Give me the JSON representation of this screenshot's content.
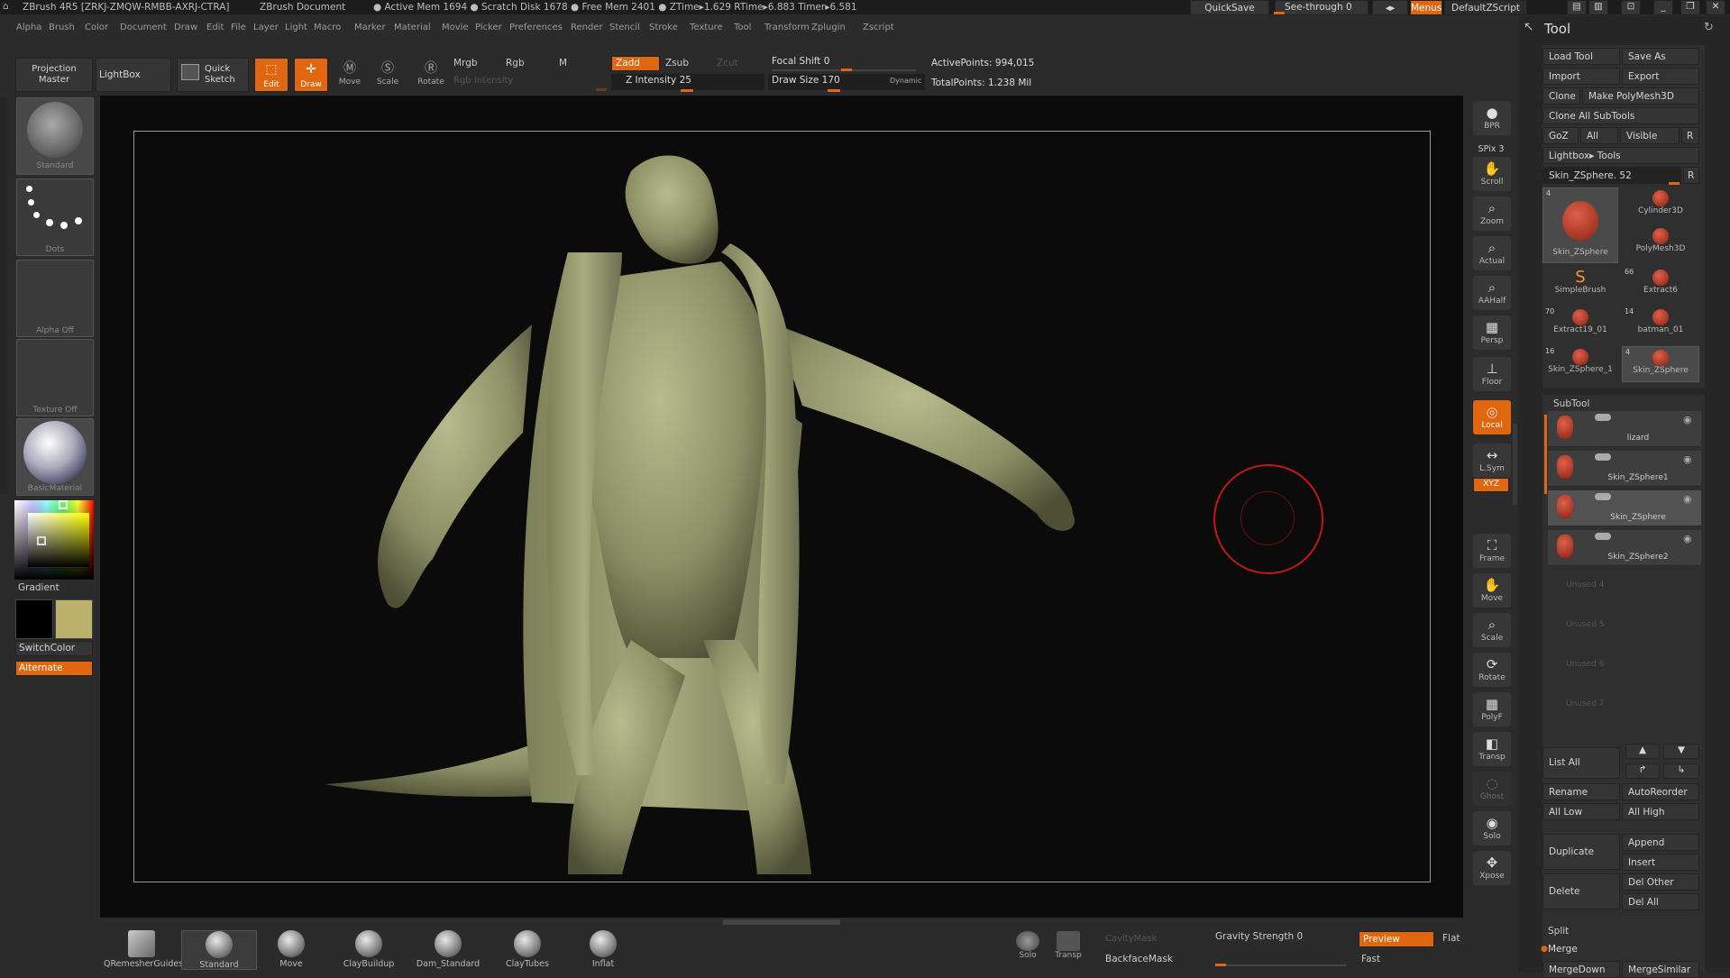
{
  "title_bar": {
    "app": "ZBrush 4R5 [ZRKJ-ZMQW-RMBB-AXRJ-CTRA]",
    "doc": "ZBrush Document",
    "stats": "● Active Mem 1694 ● Scratch Disk 1678 ● Free Mem 2401 ● ZTime▸1.629 RTime▸6.883 Timer▸6.581",
    "quicksave": "QuickSave",
    "see_through": "See-through  0",
    "menus": "Menus",
    "script": "DefaultZScript"
  },
  "menu": [
    "Alpha",
    "Brush",
    "Color",
    "Document",
    "Draw",
    "Edit",
    "File",
    "Layer",
    "Light",
    "Macro",
    "Marker",
    "Material",
    "Movie",
    "Picker",
    "Preferences",
    "Render",
    "Stencil",
    "Stroke",
    "Texture",
    "Tool",
    "Transform",
    "Zplugin",
    "Zscript"
  ],
  "toolbar": {
    "projection_master": "Projection Master",
    "lightbox": "LightBox",
    "quick_sketch": "Quick Sketch",
    "edit": "Edit",
    "draw": "Draw",
    "move": "Move",
    "scale": "Scale",
    "rotate": "Rotate",
    "mrgb": "Mrgb",
    "rgb": "Rgb",
    "m": "M",
    "rgb_intensity": "Rgb Intensity",
    "zadd": "Zadd",
    "zsub": "Zsub",
    "zcut": "Zcut",
    "z_intensity": "Z Intensity 25",
    "focal_shift": "Focal Shift 0",
    "draw_size": "Draw Size 170",
    "dynamic": "Dynamic",
    "active_points": "ActivePoints: 994,015",
    "total_points": "TotalPoints: 1.238 Mil"
  },
  "left_panel": {
    "standard": "Standard",
    "dots": "Dots",
    "alpha_off": "Alpha  Off",
    "texture_off": "Texture  Off",
    "basic_material": "BasicMaterial",
    "gradient": "Gradient",
    "switch_color": "SwitchColor",
    "alternate": "Alternate",
    "color_main": "#bdb06a"
  },
  "right_shelf": [
    {
      "icon": "bpr-icon",
      "label": "BPR"
    },
    {
      "icon": "hand-icon",
      "label": "Scroll"
    },
    {
      "icon": "magnifier-icon",
      "label": "Zoom"
    },
    {
      "icon": "magnifier-icon",
      "label": "Actual"
    },
    {
      "icon": "magnifier-icon",
      "label": "AAHalf"
    },
    {
      "icon": "grid-icon",
      "label": "Persp"
    },
    {
      "icon": "floor-icon",
      "label": "Floor"
    },
    {
      "icon": "local-icon",
      "label": "Local"
    },
    {
      "icon": "symmetry-icon",
      "label": "L.Sym"
    },
    {
      "icon": "xyz-icon",
      "label": "XYZ"
    },
    {
      "icon": "frame-icon",
      "label": "Frame"
    },
    {
      "icon": "hand-icon",
      "label": "Move"
    },
    {
      "icon": "magnifier-icon",
      "label": "Scale"
    },
    {
      "icon": "rotate-icon",
      "label": "Rotate"
    },
    {
      "icon": "grid-icon",
      "label": "PolyF"
    },
    {
      "icon": "transp-icon",
      "label": "Transp"
    },
    {
      "icon": "ghost-icon",
      "label": "Ghost"
    },
    {
      "icon": "solo-icon",
      "label": "Solo"
    },
    {
      "icon": "xpose-icon",
      "label": "Xpose"
    }
  ],
  "spix": "SPix 3",
  "tool_panel": {
    "title": "Tool",
    "load_tool": "Load Tool",
    "save_as": "Save As",
    "import": "Import",
    "export": "Export",
    "clone": "Clone",
    "make_polymesh": "Make PolyMesh3D",
    "clone_all": "Clone  All  SubTools",
    "goz": "GoZ",
    "all": "All",
    "visible": "Visible",
    "r": "R",
    "lightbox_tools": "Lightbox▸ Tools",
    "current_tool": "Skin_ZSphere. 52",
    "tools": [
      {
        "name": "Skin_ZSphere",
        "count": "4"
      },
      {
        "name": "Cylinder3D",
        "count": ""
      },
      {
        "name": "PolyMesh3D",
        "count": ""
      },
      {
        "name": "SimpleBrush",
        "count": ""
      },
      {
        "name": "Extract6",
        "count": "66"
      },
      {
        "name": "Extract19_01",
        "count": "70"
      },
      {
        "name": "batman_01",
        "count": "14"
      },
      {
        "name": "Skin_ZSphere_1",
        "count": "16"
      },
      {
        "name": "Skin_ZSphere",
        "count": "4"
      }
    ],
    "subtool_title": "SubTool",
    "subtools": [
      "lizard",
      "Skin_ZSphere1",
      "Skin_ZSphere",
      "Skin_ZSphere2"
    ],
    "unused": [
      "Unused 4",
      "Unused 5",
      "Unused 6",
      "Unused 7"
    ],
    "list_all": "List  All",
    "rename": "Rename",
    "autoreorder": "AutoReorder",
    "all_low": "All  Low",
    "all_high": "All  High",
    "duplicate": "Duplicate",
    "append": "Append",
    "insert": "Insert",
    "delete": "Delete",
    "del_other": "Del  Other",
    "del_all": "Del  All",
    "split": "Split",
    "merge": "Merge",
    "merge_down": "MergeDown",
    "merge_similar": "MergeSimilar"
  },
  "bottom": {
    "brushes": [
      "QRemesherGuides",
      "Standard",
      "Move",
      "ClayBuildup",
      "Dam_Standard",
      "ClayTubes",
      "Inflat"
    ],
    "solo": "Solo",
    "transp": "Transp",
    "cavity_mask": "CavityMask",
    "backface_mask": "BackfaceMask",
    "gravity": "Gravity Strength 0",
    "preview": "Preview",
    "flat": "Flat",
    "fast": "Fast"
  }
}
